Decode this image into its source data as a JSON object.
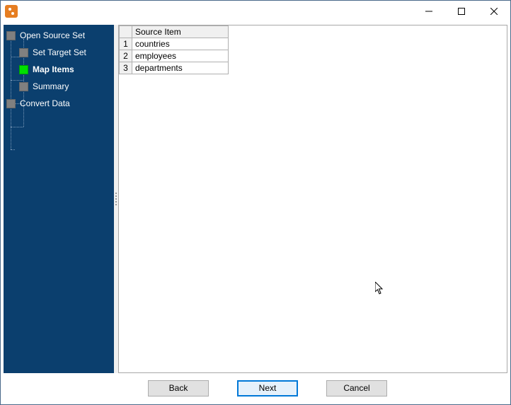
{
  "window": {
    "title": ""
  },
  "sidebar": {
    "steps": [
      {
        "id": "open-source-set",
        "label": "Open Source Set",
        "level": 0,
        "active": false
      },
      {
        "id": "set-target-set",
        "label": "Set Target Set",
        "level": 1,
        "active": false
      },
      {
        "id": "map-items",
        "label": "Map Items",
        "level": 1,
        "active": true
      },
      {
        "id": "summary",
        "label": "Summary",
        "level": 1,
        "active": false
      },
      {
        "id": "convert-data",
        "label": "Convert Data",
        "level": 0,
        "active": false
      }
    ]
  },
  "table": {
    "header": "Source Item",
    "rows": [
      {
        "n": "1",
        "item": "countries"
      },
      {
        "n": "2",
        "item": "employees"
      },
      {
        "n": "3",
        "item": "departments"
      }
    ]
  },
  "footer": {
    "back": "Back",
    "next": "Next",
    "cancel": "Cancel"
  }
}
